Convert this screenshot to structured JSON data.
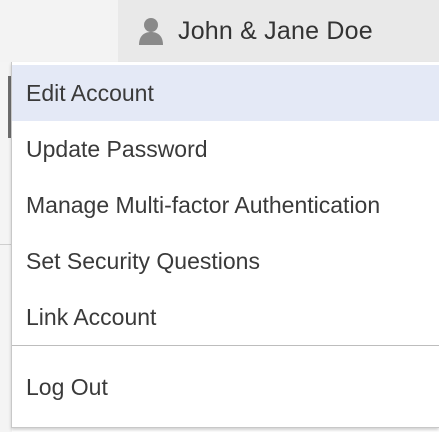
{
  "header": {
    "user_name": "John & Jane Doe",
    "user_icon": "person-icon"
  },
  "menu": {
    "items": [
      {
        "label": "Edit Account",
        "highlighted": true
      },
      {
        "label": "Update Password",
        "highlighted": false
      },
      {
        "label": "Manage Multi-factor Authentication",
        "highlighted": false
      },
      {
        "label": "Set Security Questions",
        "highlighted": false
      },
      {
        "label": "Link Account",
        "highlighted": false
      }
    ],
    "logout_label": "Log Out"
  },
  "colors": {
    "highlight": "#e4e9f6",
    "text": "#3a3a3a",
    "header_bg": "#e9e9e9",
    "icon": "#8a8a8a"
  }
}
